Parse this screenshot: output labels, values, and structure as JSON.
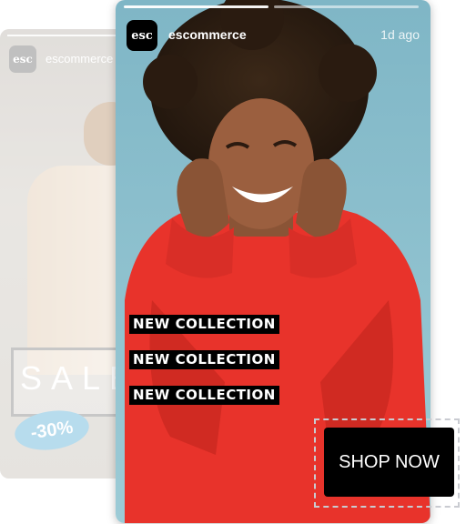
{
  "back_story": {
    "avatar_text": "esc",
    "username": "escommerce",
    "sale_text": "SALE",
    "discount": "-30%"
  },
  "main_story": {
    "avatar_text": "esc",
    "username": "escommerce",
    "time": "1d ago",
    "tags": [
      "NEW COLLECTION",
      "NEW COLLECTION",
      "NEW COLLECTION"
    ],
    "cta_label": "SHOP NOW",
    "progress_segments": 2,
    "active_segment": 1
  },
  "colors": {
    "sweater": "#e8332b",
    "background": "#8fc0cd",
    "cta": "#000000",
    "discount_badge": "#7dc0e0"
  }
}
